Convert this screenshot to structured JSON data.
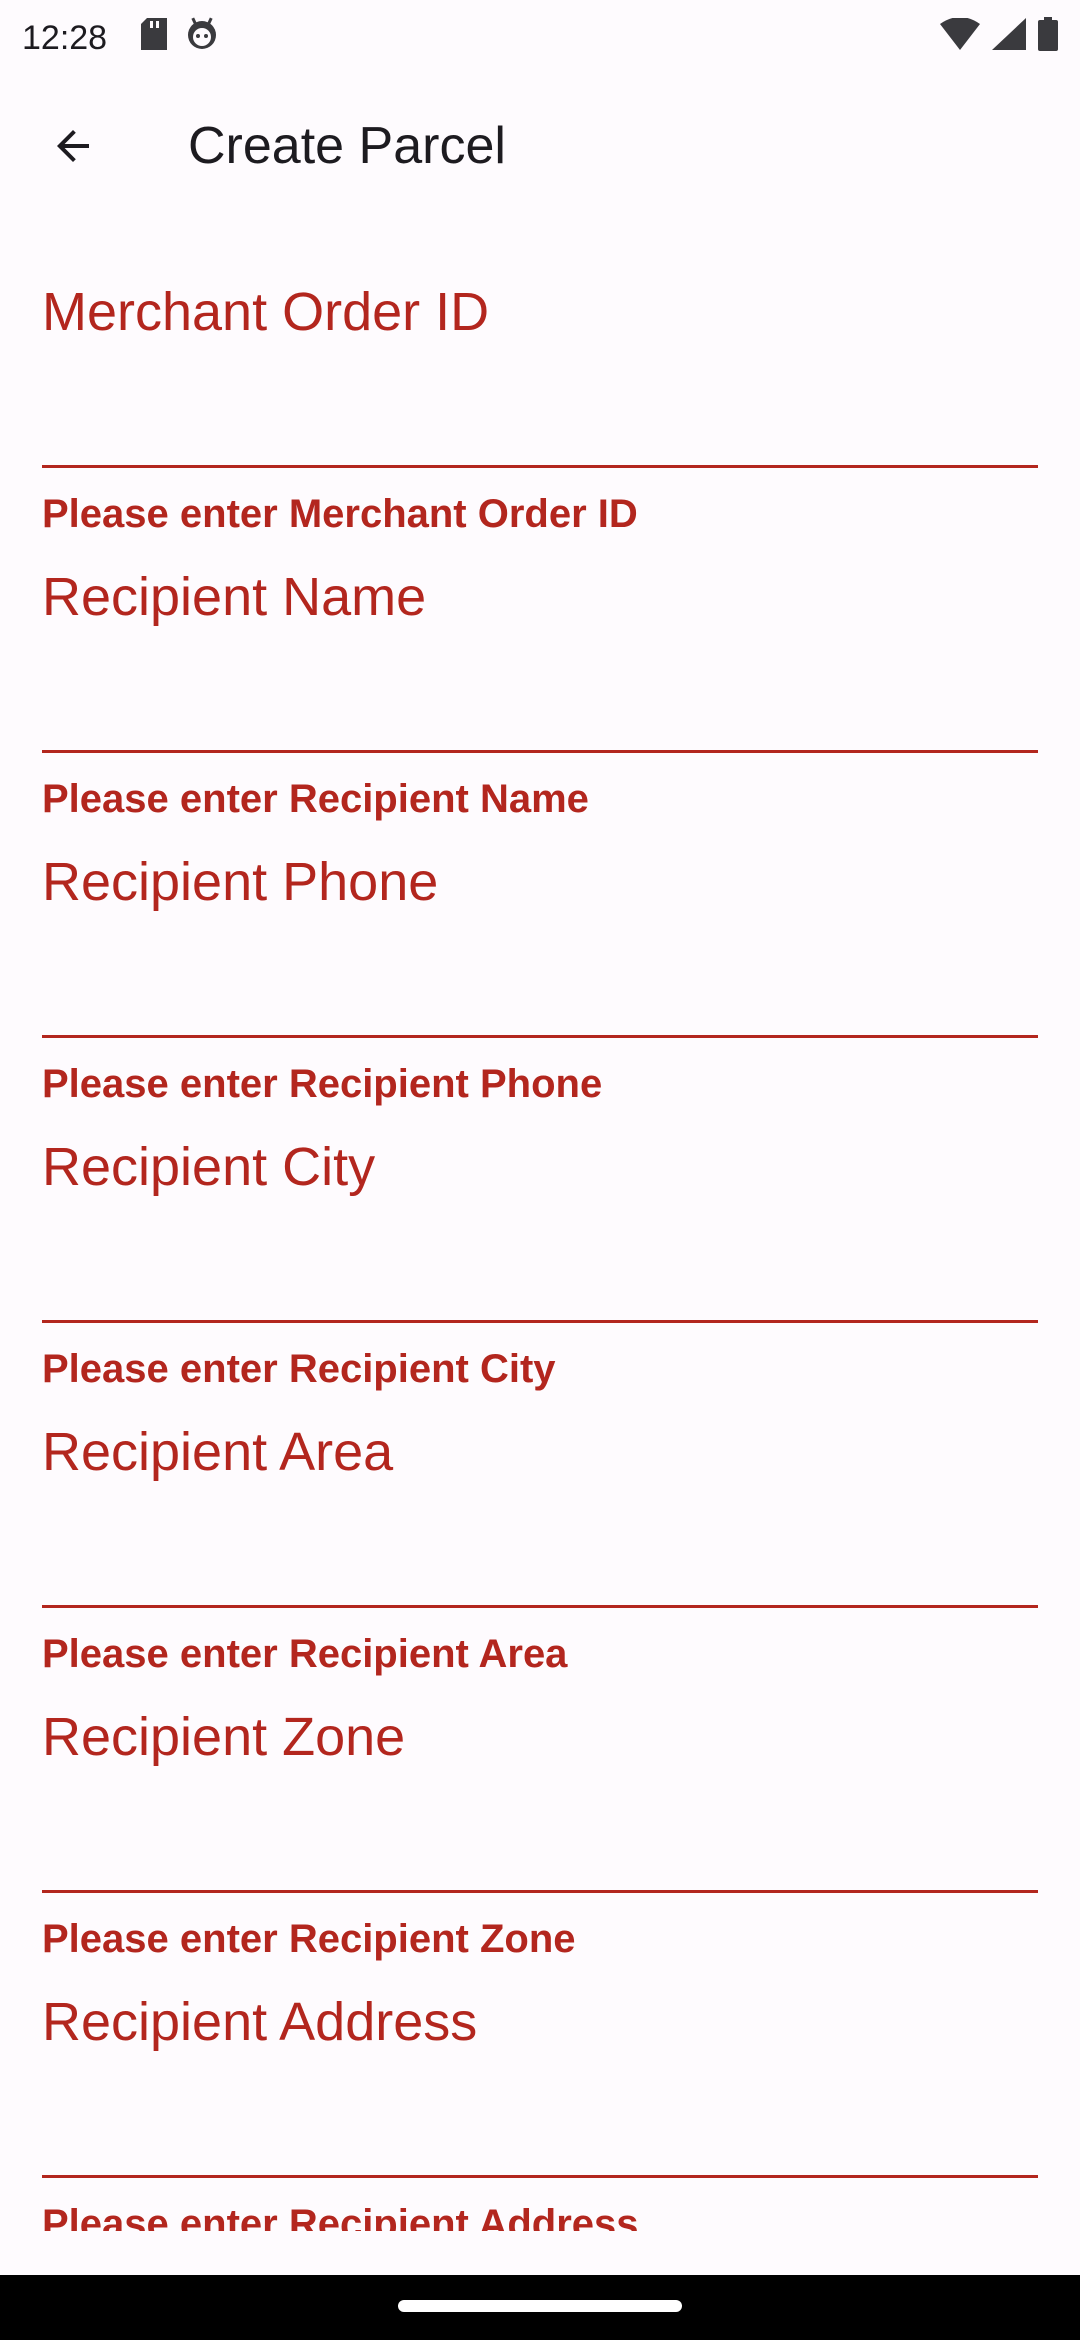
{
  "status_bar": {
    "time": "12:28",
    "left_icons": [
      "sd-card-icon",
      "android-debug-icon"
    ],
    "right_icons": [
      "wifi-icon",
      "cell-signal-icon",
      "battery-icon"
    ]
  },
  "app_bar": {
    "back_icon": "arrow-back-icon",
    "title": "Create Parcel"
  },
  "form": {
    "error_color": "#b3261e",
    "fields": [
      {
        "label": "Merchant Order ID",
        "value": "",
        "error": "Please enter Merchant Order ID"
      },
      {
        "label": "Recipient Name",
        "value": "",
        "error": "Please enter Recipient Name"
      },
      {
        "label": "Recipient Phone",
        "value": "",
        "error": "Please enter Recipient Phone"
      },
      {
        "label": "Recipient City",
        "value": "",
        "error": "Please enter Recipient City"
      },
      {
        "label": "Recipient Area",
        "value": "",
        "error": "Please enter Recipient Area"
      },
      {
        "label": "Recipient Zone",
        "value": "",
        "error": "Please enter Recipient Zone"
      },
      {
        "label": "Recipient Address",
        "value": "",
        "error": "Please enter Recipient Address"
      }
    ]
  }
}
